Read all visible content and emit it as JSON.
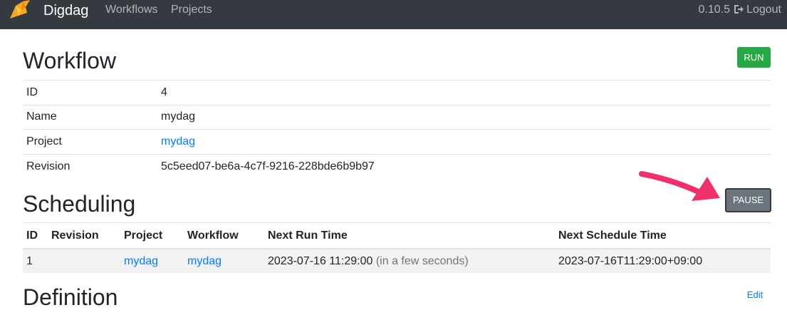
{
  "navbar": {
    "brand": "Digdag",
    "links": [
      "Workflows",
      "Projects"
    ],
    "version": "0.10.5",
    "logout_label": "Logout",
    "logout_icon": "sign-out-icon",
    "logo_icon": "digdag-bird-logo"
  },
  "workflow": {
    "title": "Workflow",
    "run_label": "RUN",
    "rows": [
      {
        "key": "ID",
        "value": "4"
      },
      {
        "key": "Name",
        "value": "mydag"
      },
      {
        "key": "Project",
        "value": "mydag"
      },
      {
        "key": "Revision",
        "value": "5c5eed07-be6a-4c7f-9216-228bde6b9b97"
      }
    ]
  },
  "scheduling": {
    "title": "Scheduling",
    "pause_label": "PAUSE",
    "columns": [
      "ID",
      "Revision",
      "Project",
      "Workflow",
      "Next Run Time",
      "Next Schedule Time"
    ],
    "rows": [
      {
        "id": "1",
        "revision": "",
        "project": "mydag",
        "workflow": "mydag",
        "next_run_time": "2023-07-16 11:29:00",
        "next_run_note": "(in a few seconds)",
        "next_schedule_time": "2023-07-16T11:29:00+09:00"
      }
    ]
  },
  "definition": {
    "title": "Definition",
    "edit_label": "Edit"
  },
  "colors": {
    "navbar": "#343a40",
    "run": "#28a745",
    "pause": "#6c757d",
    "link": "#007bff",
    "annotation_arrow": "#f0306a"
  }
}
